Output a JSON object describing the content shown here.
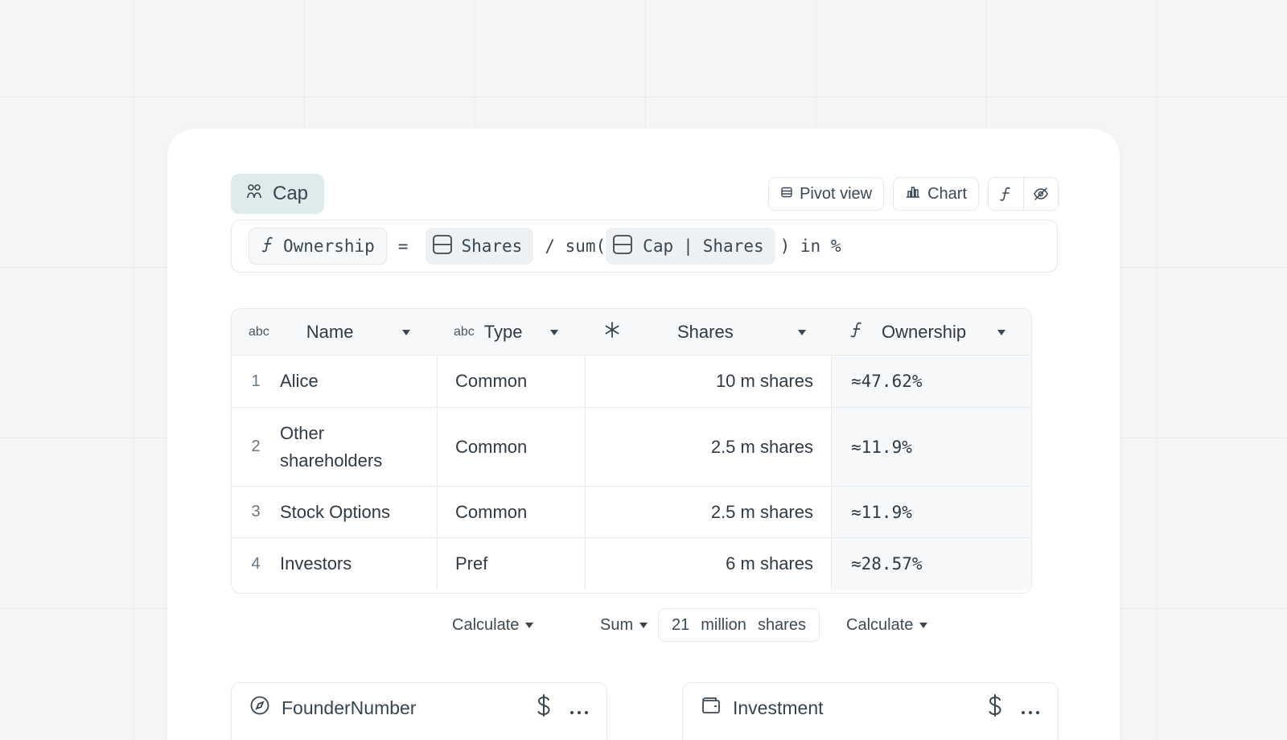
{
  "header": {
    "table_title": "Cap",
    "pivot_label": "Pivot view",
    "chart_label": "Chart"
  },
  "formula": {
    "target": "Ownership",
    "equals": "=",
    "ref1": "Shares",
    "op": "/ sum(",
    "ref2_table": "Cap",
    "ref2_sep": "|",
    "ref2_field": "Shares",
    "close": ") in %"
  },
  "columns": [
    {
      "type": "abc",
      "label": "Name"
    },
    {
      "type": "abc",
      "label": "Type"
    },
    {
      "type": "*",
      "label": "Shares"
    },
    {
      "type": "f",
      "label": "Ownership"
    }
  ],
  "rows": [
    {
      "num": "1",
      "name": "Alice",
      "type": "Common",
      "shares": "10 m shares",
      "ownership": "≈47.62%"
    },
    {
      "num": "2",
      "name": "Other shareholders",
      "type": "Common",
      "shares": "2.5 m shares",
      "ownership": "≈11.9%"
    },
    {
      "num": "3",
      "name": "Stock Options",
      "type": "Common",
      "shares": "2.5 m shares",
      "ownership": "≈11.9%"
    },
    {
      "num": "4",
      "name": "Investors",
      "type": "Pref",
      "shares": "6 m shares",
      "ownership": "≈28.57%"
    }
  ],
  "summary": {
    "type_calc": "Calculate",
    "shares_agg": "Sum",
    "shares_total_num": "21",
    "shares_total_unit": "million",
    "shares_total_suffix": "shares",
    "ownership_calc": "Calculate"
  },
  "widgets": [
    {
      "label": "FounderNumber",
      "icon": "compass-icon"
    },
    {
      "label": "Investment",
      "icon": "wallet-icon"
    }
  ]
}
